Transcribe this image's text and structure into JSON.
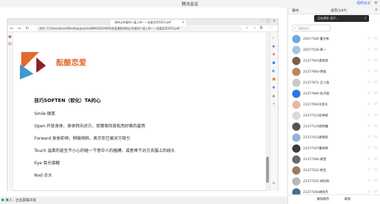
{
  "window": {
    "title": "腾讯会议",
    "share_label": "视频会议"
  },
  "browser": {
    "tab_title": "如何让你爱的人爱上你——恋爱话术2023.pdf",
    "address": "文件 | C:/Users/jianxl/Desktop/psycho/BNA/20230605恋爱课程/如何让你爱的人爱上你——恋爱话术2023.pdf"
  },
  "slide": {
    "title": "酝酿恋爱",
    "heading": "技巧SOFTEN（软化）TA的心",
    "lines": [
      "Smile 微笑",
      "Open 开放身体、身体转向对方，双臂保持放松而好客的姿势",
      "Forward 身体前倾，稍微倾斜，表示你已被对方吸引",
      "Touch 温柔的甚至不小心的碰一下意中人的胳膊，或者搀下对方衣服上的线头",
      "Eye 目光接触",
      "Nod 点头"
    ]
  },
  "panel": {
    "tab_chat": "聊天",
    "tab_members": "成员(147)",
    "toast": "正在讲话: 程子...",
    "search_placeholder": "搜索成员",
    "members": [
      "20377184-董文彬",
      "20377228-黄一",
      "21377041黄莫莫",
      "21377060-明强",
      "21377072 王小渔",
      "21377089-张子越",
      "21377092刘思礼",
      "21377112赵钟斌",
      "21377119周明曦",
      "21377103黄锦跃",
      "21377167董婉倩",
      "21377184-黄慧",
      "21377222-杨宝",
      "21377225-胡剑阳",
      "21377260胡晓杰"
    ],
    "footer_left": "解除静音",
    "footer_right": "邀请"
  },
  "status": {
    "text": "某人 · 正在屏幕共享"
  }
}
